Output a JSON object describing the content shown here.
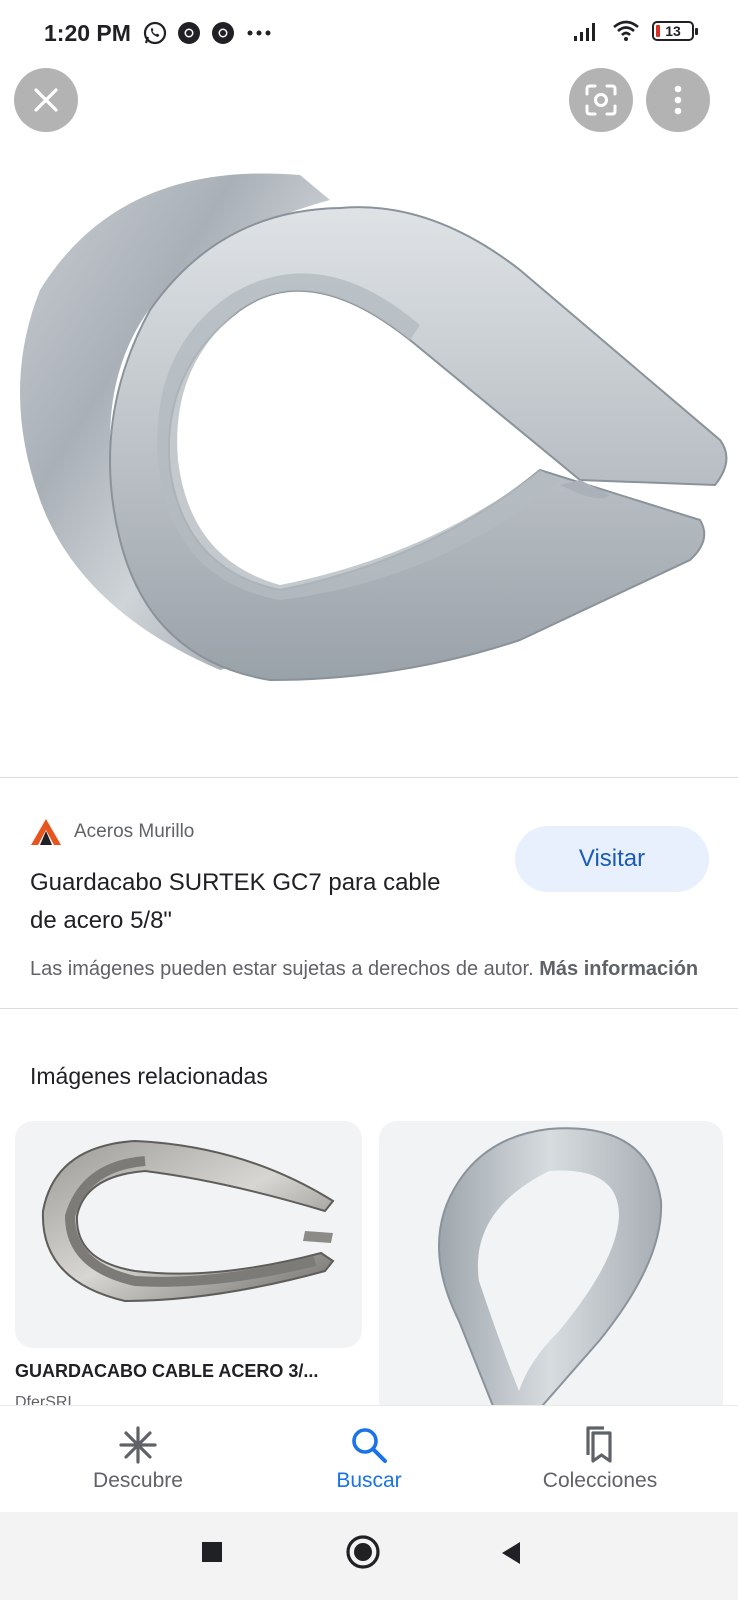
{
  "status_bar": {
    "time": "1:20 PM",
    "battery": "13"
  },
  "source": {
    "name": "Aceros Murillo"
  },
  "result": {
    "title": "Guardacabo SURTEK GC7 para cable de acero 5/8\"",
    "visit_label": "Visitar",
    "copyright_text": "Las imágenes pueden estar sujetas a derechos de autor.",
    "more_info_label": "Más información"
  },
  "related": {
    "heading": "Imágenes relacionadas",
    "items": [
      {
        "title": "GUARDACABO CABLE ACERO 3/...",
        "source": "DferSRL"
      },
      {
        "title": "",
        "source": ""
      }
    ]
  },
  "bottom_nav": {
    "items": [
      {
        "label": "Descubre",
        "icon": "asterisk-icon"
      },
      {
        "label": "Buscar",
        "icon": "search-icon"
      },
      {
        "label": "Colecciones",
        "icon": "bookmarks-icon"
      }
    ]
  },
  "colors": {
    "accent": "#1a73e8",
    "visit_bg": "#e8f0fe",
    "logo_orange": "#e8541e"
  }
}
